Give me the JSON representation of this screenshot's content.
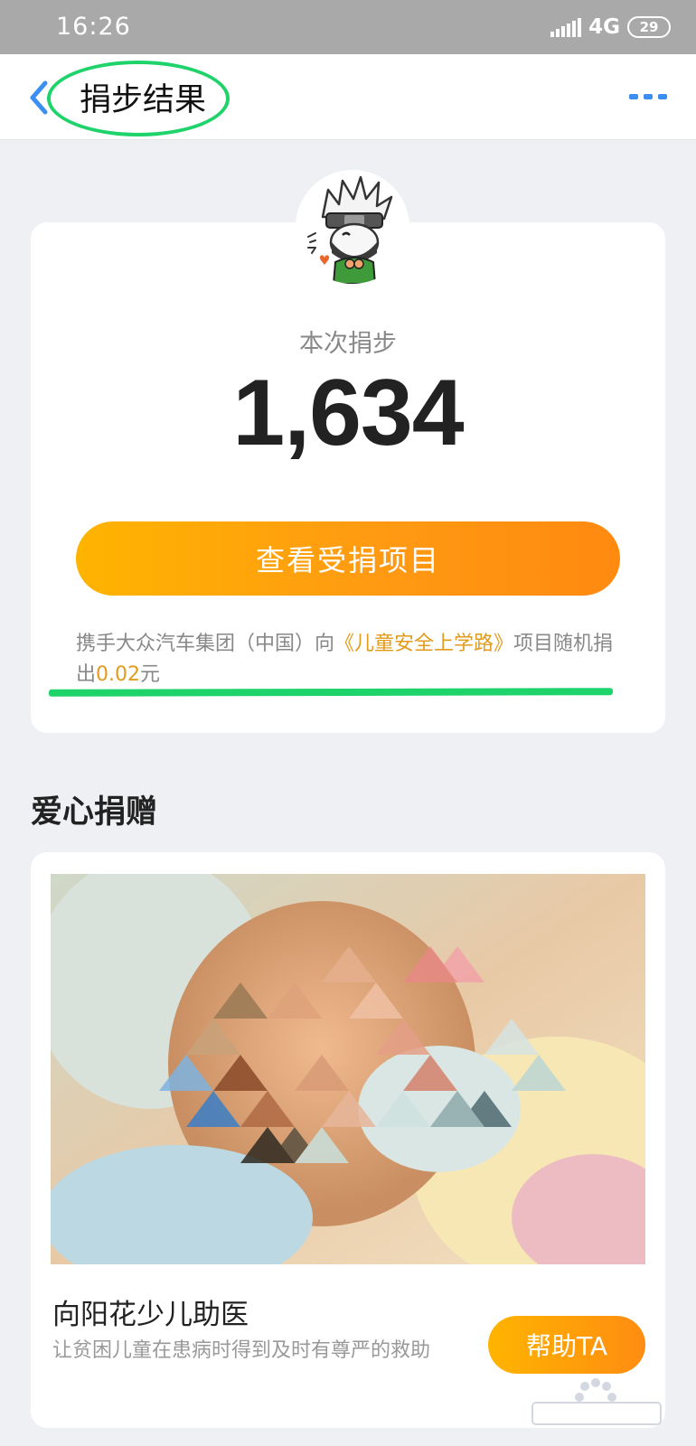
{
  "status_bar": {
    "time": "16:26",
    "network": "4G",
    "battery": "29"
  },
  "nav": {
    "title": "捐步结果",
    "back_icon": "chevron-left-icon",
    "more_icon": "more-dots-icon"
  },
  "result": {
    "label": "本次捐步",
    "steps": "1,634",
    "view_button": "查看受捐项目",
    "desc_prefix": "携手大众汽车集团（中国）向",
    "desc_project": "《儿童安全上学路》",
    "desc_mid": "项目随机捐出",
    "desc_amount": "0.02",
    "desc_suffix": "元"
  },
  "charity": {
    "heading": "爱心捐赠",
    "project_name": "向阳花少儿助医",
    "project_desc": "让贫困儿童在患病时得到及时有尊严的救助",
    "help_button": "帮助TA"
  },
  "colors": {
    "accent_orange": "#ffa50c",
    "highlight": "#e29b1c",
    "annotation_green": "#1fd36b",
    "nav_blue": "#3a8ff0"
  }
}
